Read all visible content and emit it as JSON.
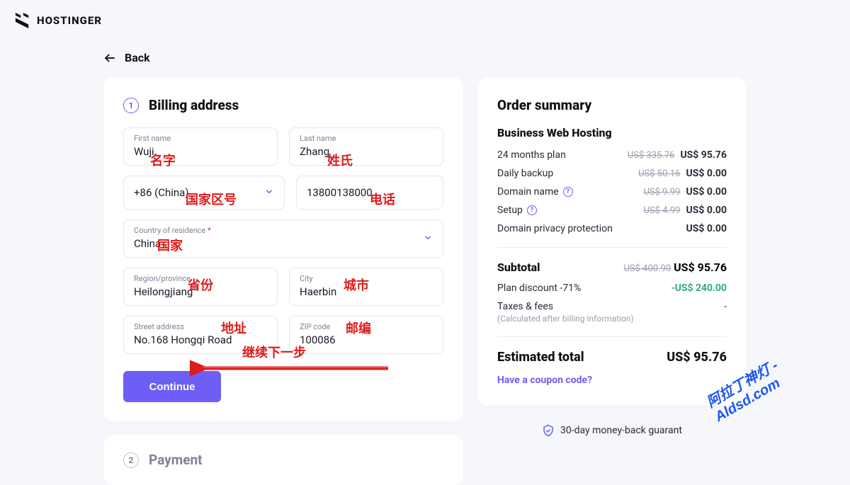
{
  "brand": "HOSTINGER",
  "back_label": "Back",
  "billing": {
    "step": "1",
    "title": "Billing address",
    "first_name_label": "First name",
    "first_name_value": "Wuji",
    "last_name_label": "Last name",
    "last_name_value": "Zhang",
    "phone_code": "+86 (China)",
    "phone_value": "13800138000",
    "country_label": "Country of residence",
    "country_value": "China",
    "region_label": "Region/province",
    "region_value": "Heilongjiang",
    "city_label": "City",
    "city_value": "Haerbin",
    "street_label": "Street address",
    "street_value": "No.168 Hongqi Road",
    "zip_label": "ZIP code",
    "zip_value": "100086",
    "continue_label": "Continue"
  },
  "payment": {
    "step": "2",
    "title": "Payment"
  },
  "summary": {
    "title": "Order summary",
    "plan_name": "Business Web Hosting",
    "lines": [
      {
        "label": "24 months plan",
        "strike": "US$ 335.76",
        "price": "US$ 95.76",
        "info": false
      },
      {
        "label": "Daily backup",
        "strike": "US$ 50.16",
        "price": "US$ 0.00",
        "info": false
      },
      {
        "label": "Domain name",
        "strike": "US$ 9.99",
        "price": "US$ 0.00",
        "info": true
      },
      {
        "label": "Setup",
        "strike": "US$ 4.99",
        "price": "US$ 0.00",
        "info": true
      },
      {
        "label": "Domain privacy protection",
        "strike": "",
        "price": "US$ 0.00",
        "info": false
      }
    ],
    "subtotal_label": "Subtotal",
    "subtotal_strike": "US$ 400.90",
    "subtotal_price": "US$ 95.76",
    "discount_label": "Plan discount -71%",
    "discount_value": "-US$ 240.00",
    "taxes_label": "Taxes & fees",
    "taxes_value": "-",
    "taxes_note": "(Calculated after billing information)",
    "estimated_label": "Estimated total",
    "estimated_value": "US$ 95.76",
    "coupon_label": "Have a coupon code?",
    "guarantee_label": "30-day money-back guarant"
  },
  "annotations": {
    "first_name": "名字",
    "last_name": "姓氏",
    "phone_code": "国家区号",
    "phone": "电话",
    "country": "国家",
    "region": "省份",
    "city": "城市",
    "street": "地址",
    "zip": "邮编",
    "continue": "继续下一步",
    "watermark1": "阿拉丁神灯 - Aldsd.com"
  }
}
